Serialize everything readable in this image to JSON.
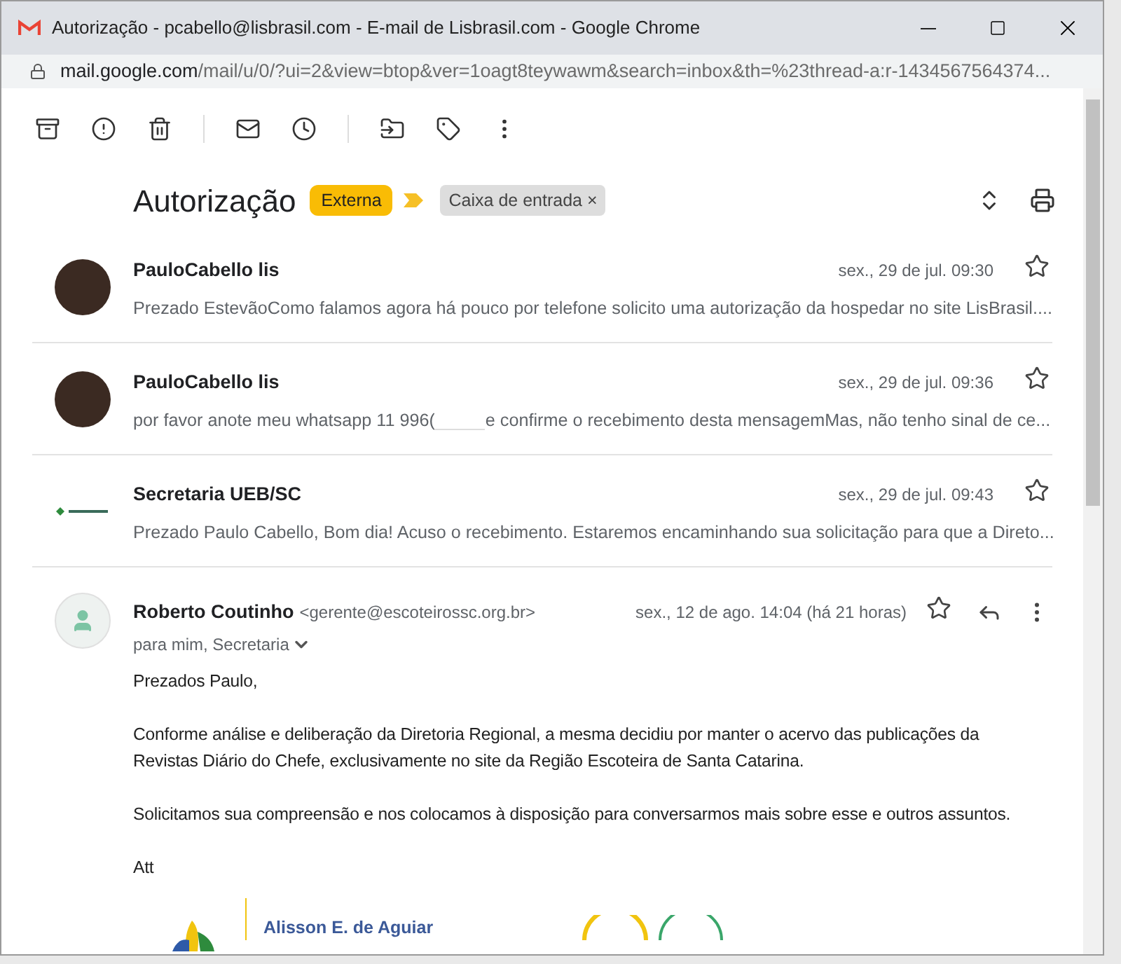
{
  "window": {
    "title": "Autorização - pcabello@lisbrasil.com - E-mail de Lisbrasil.com - Google Chrome",
    "url_host": "mail.google.com",
    "url_path": "/mail/u/0/?ui=2&view=btop&ver=1oagt8teywawm&search=inbox&th=%23thread-a:r-1434567564374..."
  },
  "subject": {
    "title": "Autorização",
    "labels": [
      {
        "text": "Externa",
        "kind": "badge"
      },
      {
        "text": "Caixa de entrada",
        "kind": "removable",
        "remove_mark": "×"
      }
    ]
  },
  "messages": [
    {
      "kind": "photo",
      "sender": "PauloCabello lis",
      "date": "sex., 29 de jul. 09:30",
      "starred": false,
      "snippet": [
        "Prezado EstevãoComo falamos agora há pouco por telefone solicito uma autorização da hospedar no site LisBrasil...."
      ]
    },
    {
      "kind": "photo",
      "sender": "PauloCabello lis",
      "date": "sex., 29 de jul. 09:36",
      "starred": false,
      "snippet": [
        "por favor anote meu whatsapp 11 996(",
        "e confirme o recebimento desta mensagemMas, não tenho sinal de ce..."
      ]
    },
    {
      "kind": "logo",
      "sender": "Secretaria UEB/SC",
      "date": "sex., 29 de jul. 09:43",
      "starred": false,
      "snippet": [
        "Prezado Paulo Cabello, Bom dia! Acuso o recebimento. Estaremos encaminhando sua solicitação para que a Direto..."
      ]
    }
  ],
  "open_message": {
    "sender": "Roberto Coutinho",
    "email": "<gerente@escoteirossc.org.br>",
    "date": "sex., 12 de ago. 14:04 (há 21 horas)",
    "starred": false,
    "recipients": "para mim, Secretaria",
    "body": [
      "Prezados Paulo,",
      "Conforme análise e deliberação da Diretoria Regional, a mesma decidiu por manter o acervo das publicações da Revistas Diário do Chefe, exclusivamente no site da Região Escoteira de Santa Catarina.",
      "Solicitamos sua compreensão e nos colocamos à disposição para conversarmos mais sobre esse e outros assuntos.",
      "Att"
    ],
    "signature_name": "Alisson E. de Aguiar"
  }
}
